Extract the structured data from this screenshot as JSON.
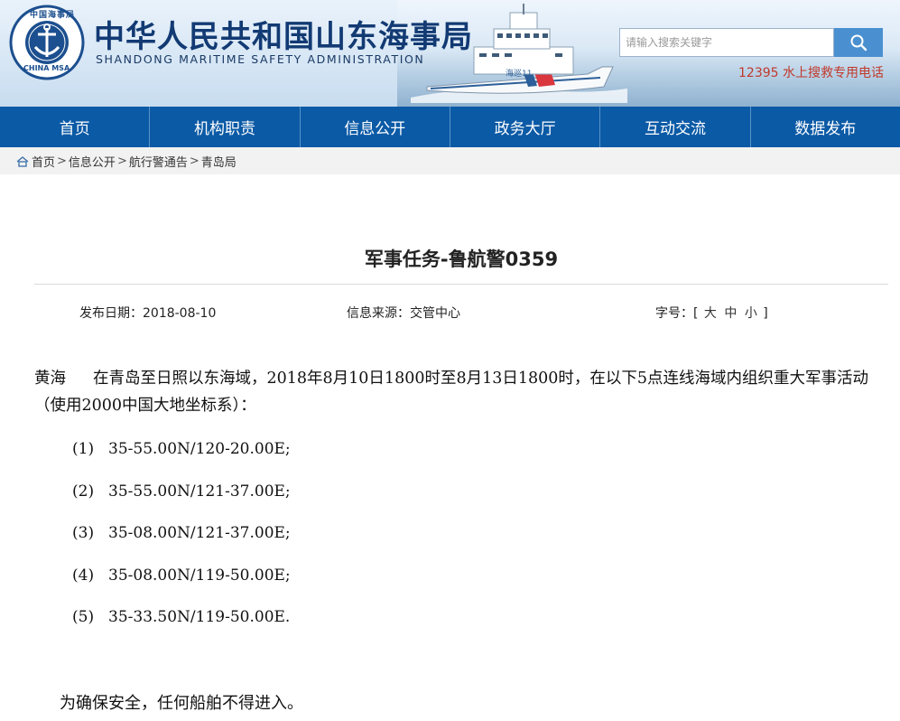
{
  "header": {
    "emblem_top_text": "中国海事局",
    "emblem_bottom_text": "CHINA MSA",
    "site_title": "中华人民共和国山东海事局",
    "site_subtitle": "SHANDONG MARITIME SAFETY ADMINISTRATION",
    "ship_mark": "海巡11",
    "search": {
      "placeholder": "请输入搜索关键字",
      "button_icon": "search-icon"
    },
    "hotline": "12395 水上搜救专用电话",
    "colors": {
      "title": "#123a73",
      "hotline": "#c0392b",
      "search_button": "#4a90d0"
    }
  },
  "nav": {
    "items": [
      "首页",
      "机构职责",
      "信息公开",
      "政务大厅",
      "互动交流",
      "数据发布"
    ],
    "background": "#0b5aa6"
  },
  "breadcrumb": {
    "home_icon": "home-icon",
    "items": [
      "首页",
      "信息公开",
      "航行警通告",
      "青岛局"
    ],
    "separator": ">"
  },
  "article": {
    "title": "军事任务-鲁航警0359",
    "meta": {
      "date_label": "发布日期：",
      "date": "2018-08-10",
      "source_label": "信息来源：",
      "source": "交管中心",
      "size_label": "字号：",
      "size_open": "[",
      "size_large": "大",
      "size_medium": "中",
      "size_small": "小",
      "size_close": "]"
    },
    "region": "黄海",
    "intro": "在青岛至日照以东海域，2018年8月10日1800时至8月13日1800时，在以下5点连线海域内组织重大军事活动（使用2000中国大地坐标系）：",
    "points": [
      {
        "no": "(1)",
        "coord": "35-55.00N/120-20.00E;"
      },
      {
        "no": "(2)",
        "coord": "35-55.00N/121-37.00E;"
      },
      {
        "no": "(3)",
        "coord": "35-08.00N/121-37.00E;"
      },
      {
        "no": "(4)",
        "coord": "35-08.00N/119-50.00E;"
      },
      {
        "no": "(5)",
        "coord": "35-33.50N/119-50.00E."
      }
    ],
    "closing": "为确保安全，任何船舶不得进入。"
  }
}
